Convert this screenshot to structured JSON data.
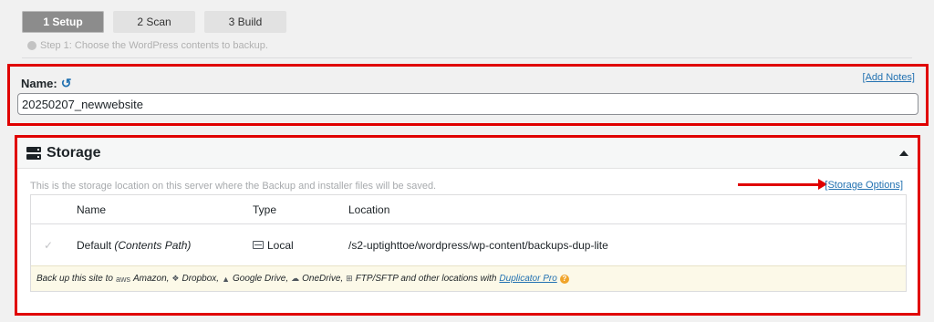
{
  "steps": [
    {
      "label": "1 Setup",
      "active": true
    },
    {
      "label": "2 Scan",
      "active": false
    },
    {
      "label": "3 Build",
      "active": false
    }
  ],
  "step_hint": "Step 1: Choose the WordPress contents to backup.",
  "name_section": {
    "label": "Name:",
    "add_notes": "[Add Notes]",
    "value": "20250207_newwebsite"
  },
  "storage": {
    "title": "Storage",
    "description": "This is the storage location on this server where the Backup and installer files will be saved.",
    "options_link": "[Storage Options]",
    "columns": [
      "Name",
      "Type",
      "Location"
    ],
    "row": {
      "name": "Default",
      "name_note": "(Contents Path)",
      "type": "Local",
      "location": "/s2-uptighttoe/wordpress/wp-content/backups-dup-lite"
    },
    "promo": {
      "prefix": "Back up this site to",
      "amazon": "Amazon,",
      "dropbox": "Dropbox,",
      "gdrive": "Google Drive,",
      "onedrive": "OneDrive,",
      "ftp": "FTP/SFTP and other locations with",
      "link": "Duplicator Pro"
    }
  },
  "colors": {
    "highlight": "#e00000",
    "link": "#2271b1",
    "promo_bg": "#fcf9e8"
  }
}
